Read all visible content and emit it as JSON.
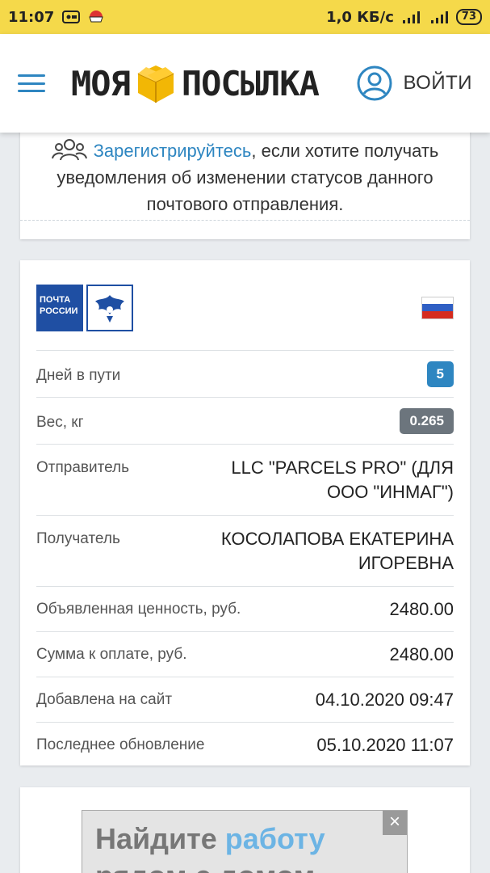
{
  "status_bar": {
    "time": "11:07",
    "network_speed": "1,0 КБ/с",
    "battery": "73",
    "colors": {
      "background": "#f5d94a"
    }
  },
  "header": {
    "logo_part1": "МОЯ",
    "logo_part2": "ПОСЫЛКА",
    "login_label": "ВОЙТИ",
    "colors": {
      "accent": "#2e86c1",
      "box": "#f2b705"
    }
  },
  "register_card": {
    "link_text": "Зарегистрируйтесь",
    "rest_text": ", если хотите получать уведомления об изменении статусов данного почтового отправления."
  },
  "parcel": {
    "carrier_logo_text": "ПОЧТА РОССИИ",
    "country_flag": "russia-flag",
    "days_in_transit_label": "Дней в пути",
    "days_in_transit_value": "5",
    "weight_label": "Вес, кг",
    "weight_value": "0.265",
    "sender_label": "Отправитель",
    "sender_value": "LLC \"PARCELS PRO\" (ДЛЯ ООО \"ИНМАГ\")",
    "recipient_label": "Получатель",
    "recipient_value": "КОСОЛАПОВА ЕКАТЕРИНА ИГОРЕВНА",
    "declared_value_label": "Объявленная ценность, руб.",
    "declared_value": "2480.00",
    "payment_label": "Сумма к оплате, руб.",
    "payment_value": "2480.00",
    "added_label": "Добавлена на сайт",
    "added_value": "04.10.2020 09:47",
    "updated_label": "Последнее обновление",
    "updated_value": "05.10.2020 11:07"
  },
  "ad": {
    "line1_prefix": "Найдите ",
    "line1_accent": "работу",
    "line2": "рядом с домом",
    "close_label": "×"
  }
}
